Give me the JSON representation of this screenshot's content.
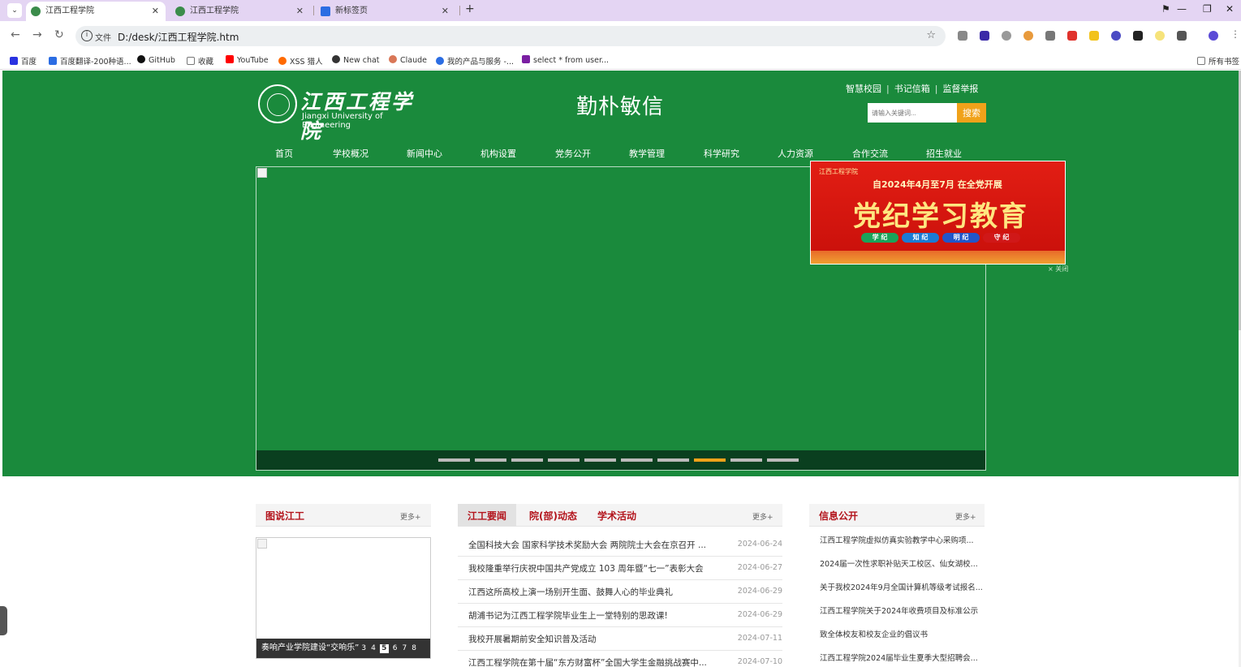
{
  "browser": {
    "tabs": [
      {
        "title": "江西工程学院",
        "active": true
      },
      {
        "title": "江西工程学院",
        "active": false
      },
      {
        "title": "新标签页",
        "active": false
      }
    ],
    "new_tab": "+",
    "url_scheme": "文件",
    "url": "D:/desk/江西工程学院.htm",
    "bookmarks": [
      {
        "label": "百度",
        "color": "#2932e1"
      },
      {
        "label": "百度翻译-200种语...",
        "color": "#2b6de3"
      },
      {
        "label": "GitHub",
        "color": "#111111"
      },
      {
        "label": "收藏",
        "color": "#777777"
      },
      {
        "label": "YouTube",
        "color": "#ff0000"
      },
      {
        "label": "XSS 猎人",
        "color": "#ff6a00"
      },
      {
        "label": "New chat",
        "color": "#333333"
      },
      {
        "label": "Claude",
        "color": "#d97757"
      },
      {
        "label": "我的产品与服务 -...",
        "color": "#2b6de3"
      },
      {
        "label": "select * from user...",
        "color": "#7a1fa2"
      }
    ],
    "all_bookmarks": "所有书签"
  },
  "site": {
    "logo_cn": "江西工程学院",
    "logo_en": "Jiangxi University of Engineering",
    "motto": "勤朴敏信",
    "top_links": [
      "智慧校园",
      "书记信箱",
      "监督举报"
    ],
    "search_placeholder": "请输入关键词...",
    "search_button": "搜索",
    "nav": [
      "首页",
      "学校概况",
      "新闻中心",
      "机构设置",
      "党务公开",
      "教学管理",
      "科学研究",
      "人力资源",
      "合作交流",
      "招生就业"
    ],
    "slider_dots": 10,
    "slider_active_dot": 8,
    "banner": {
      "org": "江西工程学院",
      "date_line": "自2024年4月至7月 在全党开展",
      "title": "党纪学习教育",
      "tags": [
        "学 纪",
        "知 纪",
        "明 纪",
        "守 纪"
      ],
      "close": "× 关闭"
    }
  },
  "sections": {
    "photos": {
      "title": "图说江工",
      "more": "更多+",
      "caption": "奏响产业学院建设“交响乐”",
      "pages": [
        "3",
        "4",
        "5",
        "6",
        "7",
        "8"
      ],
      "current_page": "5"
    },
    "news": {
      "tabs": [
        "江工要闻",
        "院(部)动态",
        "学术活动"
      ],
      "more": "更多+",
      "items": [
        {
          "title": "全国科技大会 国家科学技术奖励大会 两院院士大会在京召开 ...",
          "date": "2024-06-24"
        },
        {
          "title": "我校隆重举行庆祝中国共产党成立 103 周年暨“七一”表彰大会",
          "date": "2024-06-27"
        },
        {
          "title": "江西这所高校上演一场别开生面、鼓舞人心的毕业典礼",
          "date": "2024-06-29"
        },
        {
          "title": "胡浦书记为江西工程学院毕业生上一堂特别的思政课!",
          "date": "2024-06-29"
        },
        {
          "title": "我校开展暑期前安全知识普及活动",
          "date": "2024-07-11"
        },
        {
          "title": "江西工程学院在第十届“东方财富杯”全国大学生金融挑战赛中...",
          "date": "2024-07-10"
        }
      ]
    },
    "info": {
      "title": "信息公开",
      "more": "更多+",
      "items": [
        "江西工程学院虚拟仿真实验教学中心采购项...",
        "2024届一次性求职补贴天工校区、仙女湖校...",
        "关于我校2024年9月全国计算机等级考试报名...",
        "江西工程学院关于2024年收费项目及标准公示",
        "致全体校友和校友企业的倡议书",
        "江西工程学院2024届毕业生夏季大型招聘会..."
      ]
    }
  }
}
